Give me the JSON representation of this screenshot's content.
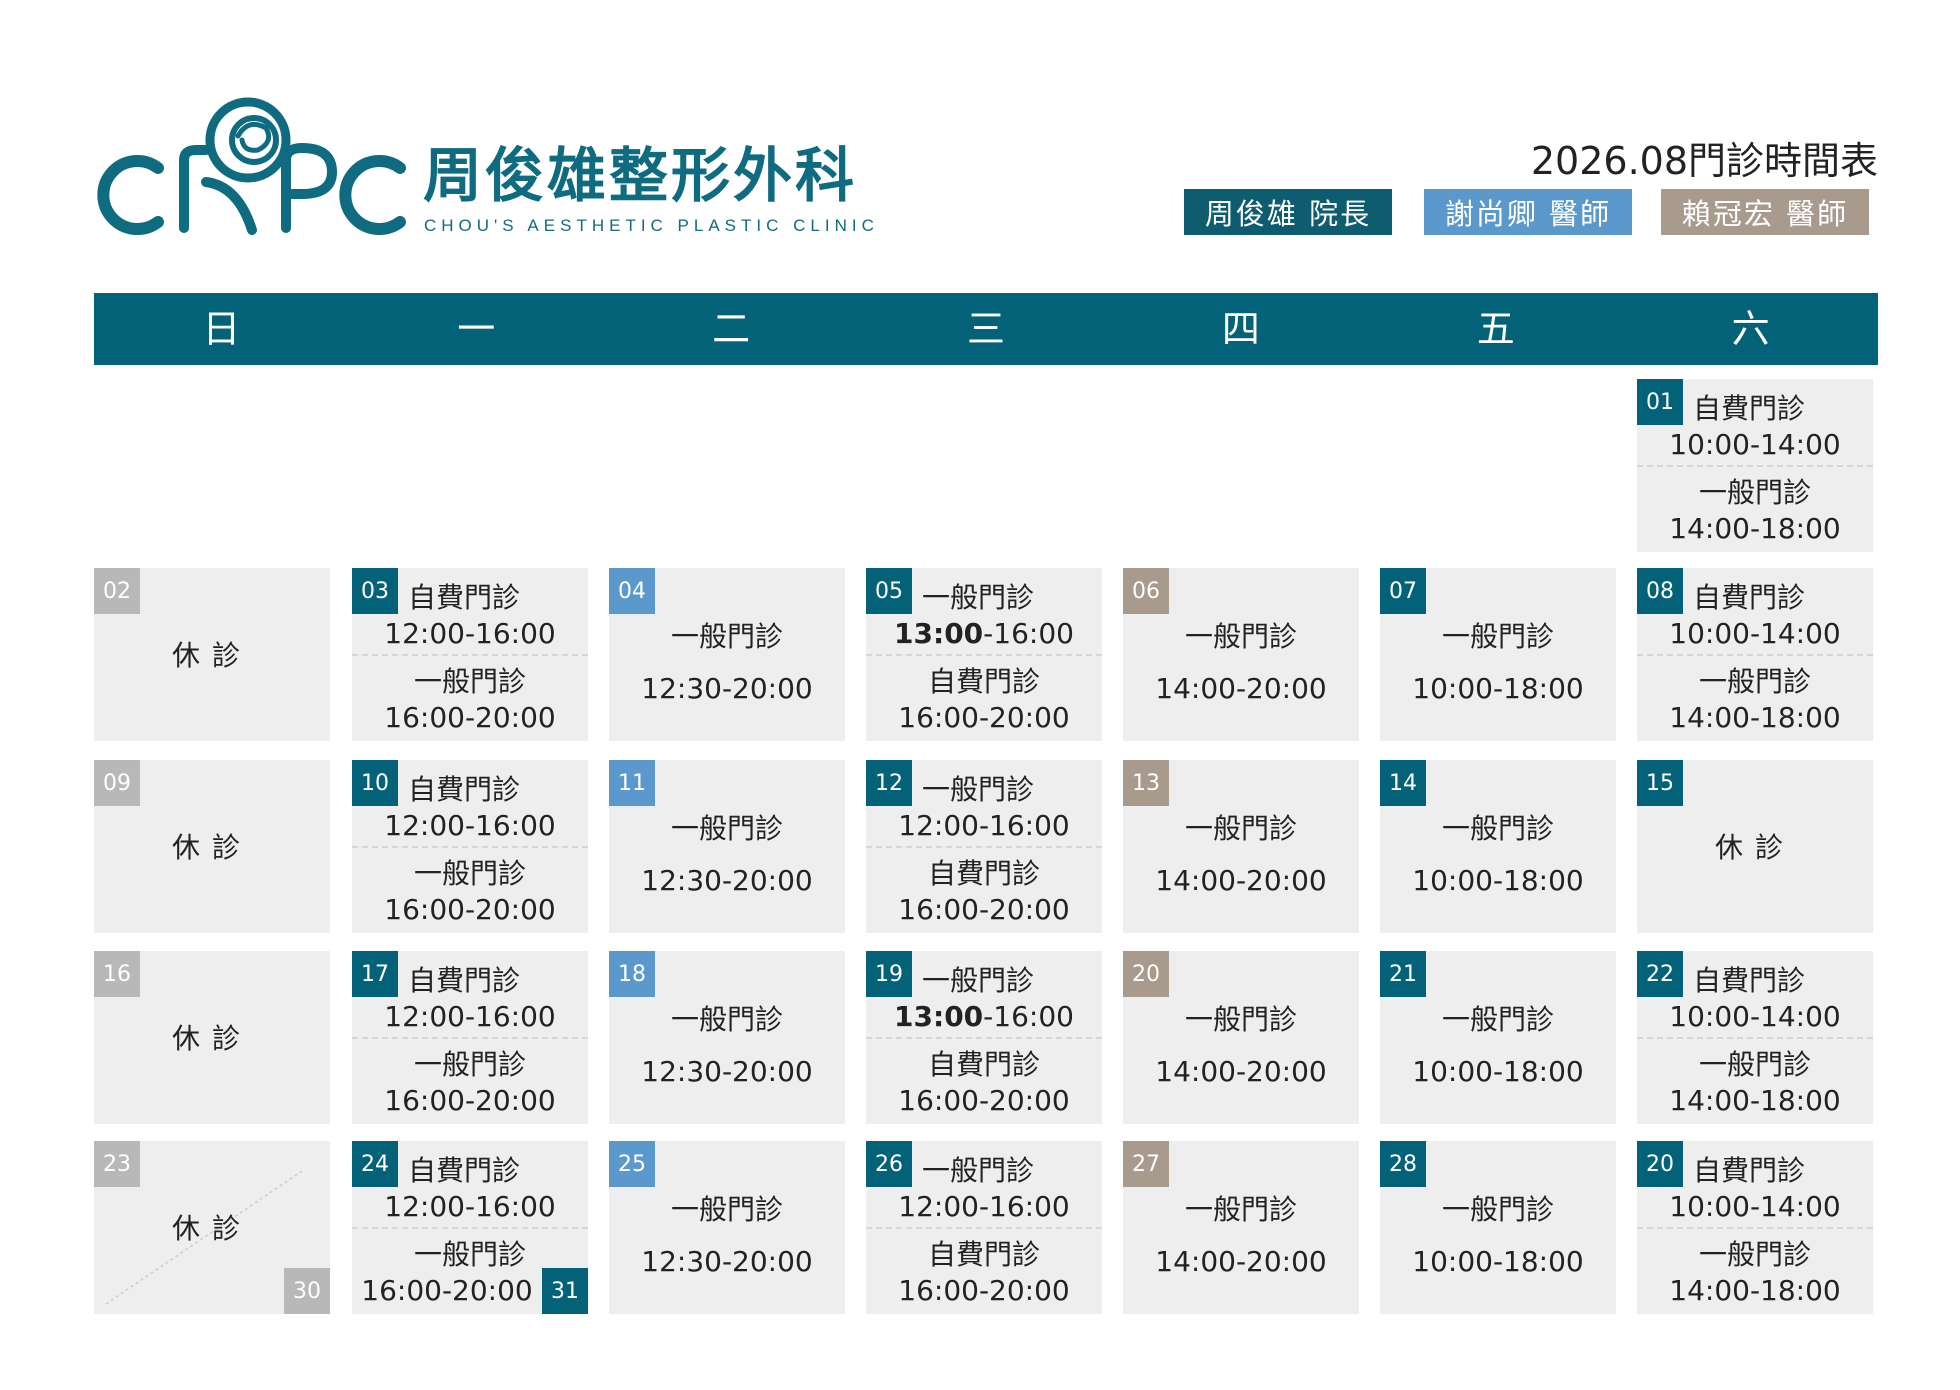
{
  "clinic": {
    "logo_letters": "CPPC",
    "name_zh": "周俊雄整形外科",
    "name_en": "CHOU'S AESTHETIC PLASTIC CLINIC"
  },
  "title": "2026.08門診時間表",
  "colors": {
    "teal": "#036278",
    "blue": "#5b98cc",
    "taupe": "#a89a8c",
    "gray": "#b8b8b8",
    "cell_bg": "#eeeeee"
  },
  "legend": [
    {
      "label": "周俊雄 院長",
      "color": "#0e5c70"
    },
    {
      "label": "謝尚卿 醫師",
      "color": "#5b98cc"
    },
    {
      "label": "賴冠宏 醫師",
      "color": "#a89a8c"
    }
  ],
  "weekdays": [
    "日",
    "一",
    "二",
    "三",
    "四",
    "五",
    "六"
  ],
  "days": [
    {
      "day": "01",
      "col": 6,
      "row": 0,
      "badge": "teal",
      "type": "two",
      "s1": "自費門診",
      "t1": "10:00-14:00",
      "s2": "一般門診",
      "t2": "14:00-18:00"
    },
    {
      "day": "02",
      "col": 0,
      "row": 1,
      "badge": "gray",
      "type": "closed",
      "label": "休診"
    },
    {
      "day": "03",
      "col": 1,
      "row": 1,
      "badge": "teal",
      "type": "two",
      "s1": "自費門診",
      "t1": "12:00-16:00",
      "s2": "一般門診",
      "t2": "16:00-20:00"
    },
    {
      "day": "04",
      "col": 2,
      "row": 1,
      "badge": "blue",
      "type": "one",
      "s1": "一般門診",
      "t1": "12:30-20:00"
    },
    {
      "day": "05",
      "col": 3,
      "row": 1,
      "badge": "teal",
      "type": "two",
      "s1": "一般門診",
      "t1b": "13:00",
      "t1r": "-16:00",
      "s2": "自費門診",
      "t2": "16:00-20:00"
    },
    {
      "day": "06",
      "col": 4,
      "row": 1,
      "badge": "taupe",
      "type": "one",
      "s1": "一般門診",
      "t1": "14:00-20:00"
    },
    {
      "day": "07",
      "col": 5,
      "row": 1,
      "badge": "teal",
      "type": "one",
      "s1": "一般門診",
      "t1": "10:00-18:00"
    },
    {
      "day": "08",
      "col": 6,
      "row": 1,
      "badge": "teal",
      "type": "two",
      "s1": "自費門診",
      "t1": "10:00-14:00",
      "s2": "一般門診",
      "t2": "14:00-18:00"
    },
    {
      "day": "09",
      "col": 0,
      "row": 2,
      "badge": "gray",
      "type": "closed",
      "label": "休診"
    },
    {
      "day": "10",
      "col": 1,
      "row": 2,
      "badge": "teal",
      "type": "two",
      "s1": "自費門診",
      "t1": "12:00-16:00",
      "s2": "一般門診",
      "t2": "16:00-20:00"
    },
    {
      "day": "11",
      "col": 2,
      "row": 2,
      "badge": "blue",
      "type": "one",
      "s1": "一般門診",
      "t1": "12:30-20:00"
    },
    {
      "day": "12",
      "col": 3,
      "row": 2,
      "badge": "teal",
      "type": "two",
      "s1": "一般門診",
      "t1": "12:00-16:00",
      "s2": "自費門診",
      "t2": "16:00-20:00"
    },
    {
      "day": "13",
      "col": 4,
      "row": 2,
      "badge": "taupe",
      "type": "one",
      "s1": "一般門診",
      "t1": "14:00-20:00"
    },
    {
      "day": "14",
      "col": 5,
      "row": 2,
      "badge": "teal",
      "type": "one",
      "s1": "一般門診",
      "t1": "10:00-18:00"
    },
    {
      "day": "15",
      "col": 6,
      "row": 2,
      "badge": "teal",
      "type": "closed",
      "label": "休診"
    },
    {
      "day": "16",
      "col": 0,
      "row": 3,
      "badge": "gray",
      "type": "closed",
      "label": "休診"
    },
    {
      "day": "17",
      "col": 1,
      "row": 3,
      "badge": "teal",
      "type": "two",
      "s1": "自費門診",
      "t1": "12:00-16:00",
      "s2": "一般門診",
      "t2": "16:00-20:00"
    },
    {
      "day": "18",
      "col": 2,
      "row": 3,
      "badge": "blue",
      "type": "one",
      "s1": "一般門診",
      "t1": "12:30-20:00"
    },
    {
      "day": "19",
      "col": 3,
      "row": 3,
      "badge": "teal",
      "type": "two",
      "s1": "一般門診",
      "t1b": "13:00",
      "t1r": "-16:00",
      "s2": "自費門診",
      "t2": "16:00-20:00"
    },
    {
      "day": "20",
      "col": 4,
      "row": 3,
      "badge": "taupe",
      "type": "one",
      "s1": "一般門診",
      "t1": "14:00-20:00"
    },
    {
      "day": "21",
      "col": 5,
      "row": 3,
      "badge": "teal",
      "type": "one",
      "s1": "一般門診",
      "t1": "10:00-18:00"
    },
    {
      "day": "22",
      "col": 6,
      "row": 3,
      "badge": "teal",
      "type": "two",
      "s1": "自費門診",
      "t1": "10:00-14:00",
      "s2": "一般門診",
      "t2": "14:00-18:00"
    },
    {
      "day": "23",
      "day2": "30",
      "col": 0,
      "row": 4,
      "badge": "gray",
      "badge2": "gray",
      "type": "closed",
      "label": "休診",
      "diagonal": true
    },
    {
      "day": "24",
      "day2": "31",
      "col": 1,
      "row": 4,
      "badge": "teal",
      "badge2": "teal",
      "type": "two",
      "s1": "自費門診",
      "t1": "12:00-16:00",
      "s2": "一般門診",
      "t2": "16:00-20:00"
    },
    {
      "day": "25",
      "col": 2,
      "row": 4,
      "badge": "blue",
      "type": "one",
      "s1": "一般門診",
      "t1": "12:30-20:00"
    },
    {
      "day": "26",
      "col": 3,
      "row": 4,
      "badge": "teal",
      "type": "two",
      "s1": "一般門診",
      "t1": "12:00-16:00",
      "s2": "自費門診",
      "t2": "16:00-20:00"
    },
    {
      "day": "27",
      "col": 4,
      "row": 4,
      "badge": "taupe",
      "type": "one",
      "s1": "一般門診",
      "t1": "14:00-20:00"
    },
    {
      "day": "28",
      "col": 5,
      "row": 4,
      "badge": "teal",
      "type": "one",
      "s1": "一般門診",
      "t1": "10:00-18:00"
    },
    {
      "day": "20",
      "col": 6,
      "row": 4,
      "badge": "teal",
      "type": "two",
      "s1": "自費門診",
      "t1": "10:00-14:00",
      "s2": "一般門診",
      "t2": "14:00-18:00"
    }
  ]
}
